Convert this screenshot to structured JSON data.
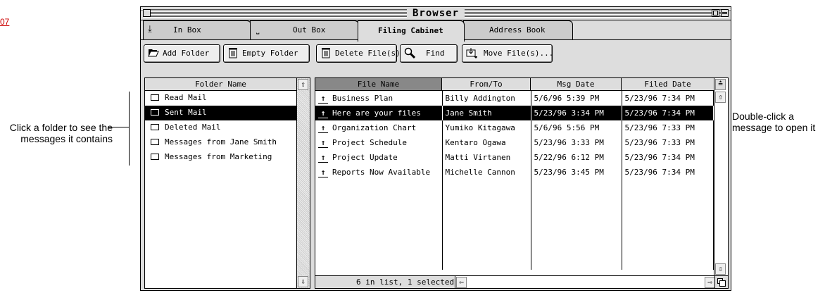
{
  "page": {
    "number": "07"
  },
  "callouts": {
    "left": "Click a folder to see the messages it contains",
    "right": "Double-click a message to open it"
  },
  "window": {
    "title": "Browser"
  },
  "tabs": [
    {
      "label": "In Box",
      "icon": "inbox-down-arrow-icon",
      "active": false
    },
    {
      "label": "Out Box",
      "icon": "outbox-tray-icon",
      "active": false
    },
    {
      "label": "Filing Cabinet",
      "active": true
    },
    {
      "label": "Address Book",
      "active": false
    }
  ],
  "toolbar": {
    "add_folder": "Add Folder",
    "empty_folder": "Empty Folder",
    "delete_files": "Delete File(s)",
    "find": "Find",
    "move_files": "Move File(s)..."
  },
  "folders": {
    "header": "Folder Name",
    "items": [
      {
        "label": "Read Mail",
        "selected": false
      },
      {
        "label": "Sent Mail",
        "selected": true
      },
      {
        "label": "Deleted Mail",
        "selected": false
      },
      {
        "label": "Messages from Jane Smith",
        "selected": false
      },
      {
        "label": "Messages from Marketing",
        "selected": false
      }
    ]
  },
  "messages": {
    "headers": {
      "file_name": "File Name",
      "from_to": "From/To",
      "msg_date": "Msg Date",
      "filed_date": "Filed Date"
    },
    "rows": [
      {
        "file_name": "Business Plan",
        "from_to": "Billy Addington",
        "msg_date": "5/6/96 5:39 PM",
        "filed_date": "5/23/96 7:34 PM",
        "selected": false
      },
      {
        "file_name": "Here are your files",
        "from_to": "Jane Smith",
        "msg_date": "5/23/96 3:34 PM",
        "filed_date": "5/23/96 7:34 PM",
        "selected": true
      },
      {
        "file_name": "Organization Chart",
        "from_to": "Yumiko Kitagawa",
        "msg_date": "5/6/96 5:56 PM",
        "filed_date": "5/23/96 7:33 PM",
        "selected": false
      },
      {
        "file_name": "Project Schedule",
        "from_to": "Kentaro Ogawa",
        "msg_date": "5/23/96 3:33 PM",
        "filed_date": "5/23/96 7:33 PM",
        "selected": false
      },
      {
        "file_name": "Project Update",
        "from_to": "Matti Virtanen",
        "msg_date": "5/22/96 6:12 PM",
        "filed_date": "5/23/96 7:34 PM",
        "selected": false
      },
      {
        "file_name": "Reports Now Available",
        "from_to": "Michelle Cannon",
        "msg_date": "5/23/96 3:45 PM",
        "filed_date": "5/23/96 7:34 PM",
        "selected": false
      }
    ],
    "status": "6 in list, 1 selected"
  }
}
